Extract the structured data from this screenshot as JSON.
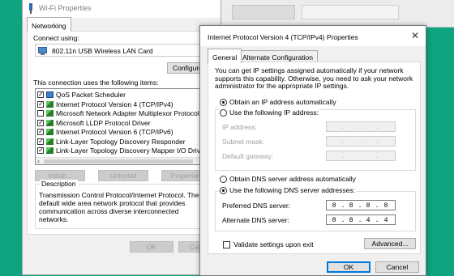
{
  "wifi_window": {
    "title": "Wi-Fi Properties",
    "tab": "Networking",
    "connect_using_label": "Connect using:",
    "adapter": "802.11n USB Wireless LAN Card",
    "configure_button": "Configure...",
    "items_label": "This connection uses the following items:",
    "items": [
      {
        "label": "QoS Packet Scheduler",
        "checked": true,
        "icon": "green-net-icon"
      },
      {
        "label": "Internet Protocol Version 4 (TCP/IPv4)",
        "checked": true,
        "icon": "green-net-icon"
      },
      {
        "label": "Microsoft Network Adapter Multiplexor Protocol",
        "checked": false,
        "icon": "green-net-icon"
      },
      {
        "label": "Microsoft LLDP Protocol Driver",
        "checked": true,
        "icon": "green-net-icon"
      },
      {
        "label": "Internet Protocol Version 6 (TCP/IPv6)",
        "checked": true,
        "icon": "green-net-icon"
      },
      {
        "label": "Link-Layer Topology Discovery Responder",
        "checked": true,
        "icon": "green-net-icon"
      },
      {
        "label": "Link-Layer Topology Discovery Mapper I/O Driver",
        "checked": true,
        "icon": "green-net-icon"
      }
    ],
    "install_button": "Install...",
    "uninstall_button": "Uninstall",
    "properties_button": "Properties",
    "description_title": "Description",
    "description_text": "Transmission Control Protocol/Internet Protocol. The default wide area network protocol that provides communication across diverse interconnected networks.",
    "ok_button": "OK",
    "cancel_button": "Cancel"
  },
  "ipv4_dialog": {
    "title": "Internet Protocol Version 4 (TCP/IPv4) Properties",
    "tabs": [
      "General",
      "Alternate Configuration"
    ],
    "intro": "You can get IP settings assigned automatically if your network supports this capability. Otherwise, you need to ask your network administrator for the appropriate IP settings.",
    "obtain_ip_auto": "Obtain an IP address automatically",
    "use_following_ip": "Use the following IP address:",
    "ip_address_label": "IP address:",
    "subnet_mask_label": "Subnet mask:",
    "default_gateway_label": "Default gateway:",
    "obtain_dns_auto": "Obtain DNS server address automatically",
    "use_following_dns": "Use the following DNS server addresses:",
    "preferred_dns_label": "Preferred DNS server:",
    "alternate_dns_label": "Alternate DNS server:",
    "preferred_dns": [
      "8",
      "8",
      "8",
      "8"
    ],
    "alternate_dns": [
      "8",
      "8",
      "4",
      "4"
    ],
    "validate_label": "Validate settings upon exit",
    "advanced_button": "Advanced...",
    "ok_button": "OK",
    "cancel_button": "Cancel"
  },
  "colors": {
    "desktop": "#0fa37f",
    "focus_border": "#0078d7"
  }
}
